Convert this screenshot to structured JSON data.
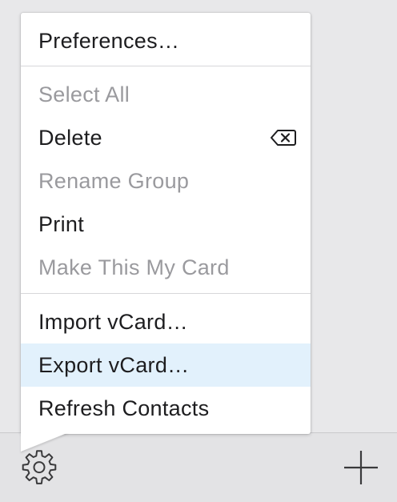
{
  "menu": {
    "items": [
      {
        "label": "Preferences…",
        "enabled": true
      },
      {
        "label": "Select All",
        "enabled": false
      },
      {
        "label": "Delete",
        "enabled": true,
        "shortcut_icon": "delete-backward-icon"
      },
      {
        "label": "Rename Group",
        "enabled": false
      },
      {
        "label": "Print",
        "enabled": true
      },
      {
        "label": "Make This My Card",
        "enabled": false
      },
      {
        "label": "Import vCard…",
        "enabled": true
      },
      {
        "label": "Export vCard…",
        "enabled": true,
        "highlighted": true
      },
      {
        "label": "Refresh Contacts",
        "enabled": true
      }
    ]
  },
  "toolbar": {
    "left_icon": "gear-icon",
    "right_icon": "plus-icon"
  },
  "colors": {
    "menu_text": "#1d1d1f",
    "menu_text_disabled": "#9a9a9e",
    "highlight": "#e2f1fc",
    "background": "#e8e8ea"
  }
}
